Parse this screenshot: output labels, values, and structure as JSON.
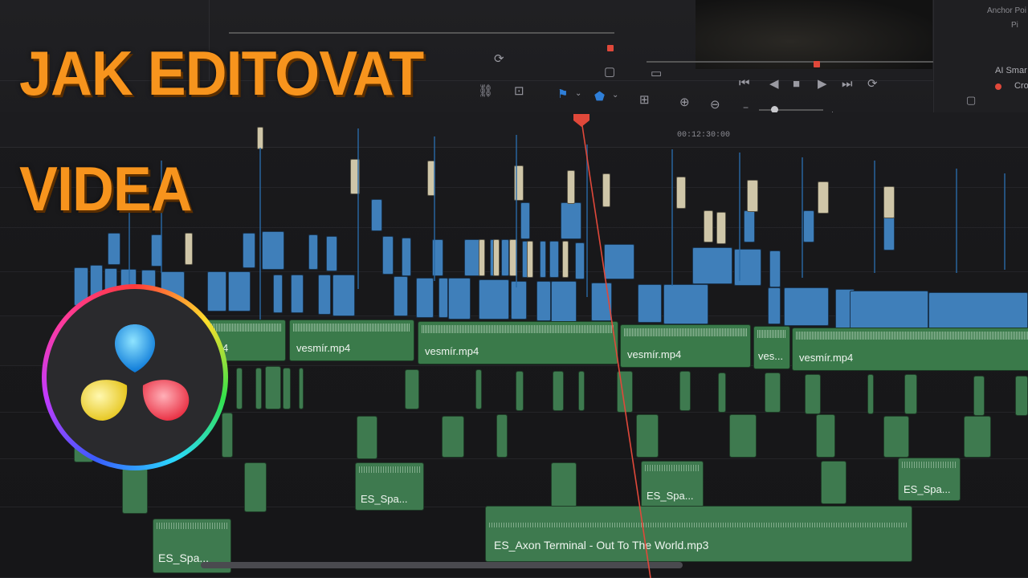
{
  "title": {
    "line1": "JAK EDITOVAT",
    "line2": "VIDEA"
  },
  "inspector": {
    "anchor_label": "Anchor Poi",
    "ai_label": "AI Smar",
    "cr_label": "Cro",
    "pi_label": "Pi"
  },
  "timeline": {
    "timecode": "00:12:30:00",
    "video_clips": [
      {
        "label": "mp4"
      },
      {
        "label": "vesmír.mp4"
      },
      {
        "label": "vesmír.mp4"
      },
      {
        "label": "vesmír.mp4"
      },
      {
        "label": "ves..."
      },
      {
        "label": "vesmír.mp4"
      }
    ],
    "audio_clips": [
      {
        "label": "ES_Spa..."
      },
      {
        "label": "ES_Spa..."
      },
      {
        "label": "ES_Spa..."
      },
      {
        "label": "ES_Spa..."
      },
      {
        "label": "ES_Axon Terminal - Out To The World.mp3"
      }
    ]
  },
  "colors": {
    "title": "#f7941d",
    "clip_blue": "#3f7fba",
    "clip_green": "#3e7a4f",
    "playhead": "#e0483a"
  },
  "icons": [
    "link-icon",
    "lock-icon",
    "flag-icon",
    "marker-icon",
    "zoom-fit-icon",
    "zoom-in-icon",
    "zoom-out-icon",
    "minus-icon",
    "plus-icon",
    "skip-back-icon",
    "play-reverse-icon",
    "stop-icon",
    "play-icon",
    "skip-forward-icon",
    "loop-icon"
  ]
}
